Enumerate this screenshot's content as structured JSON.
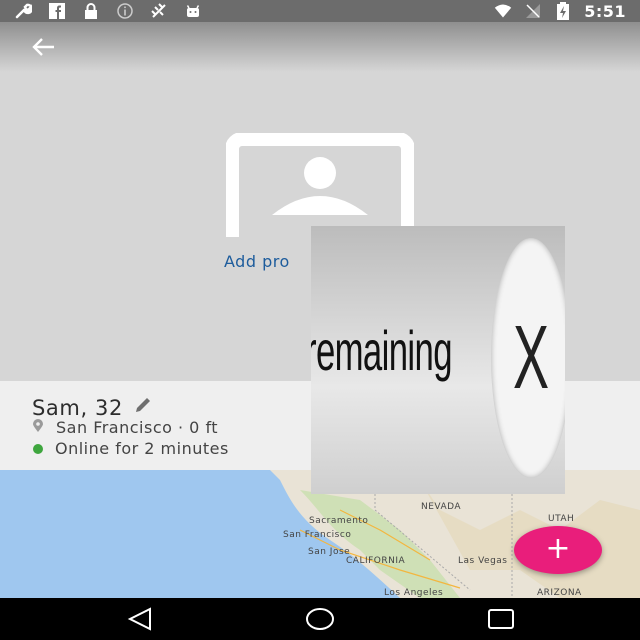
{
  "status_bar": {
    "time": "5:51",
    "left_icons": [
      "wrench-icon",
      "facebook-icon",
      "lock-icon",
      "info-icon",
      "satellite-icon",
      "android-icon"
    ],
    "right_icons": [
      "wifi-icon",
      "signal-icon",
      "battery-icon"
    ]
  },
  "header": {
    "back_icon": "arrow-left-icon"
  },
  "profile": {
    "add_photo_label": "Add pro",
    "name": "Sam",
    "age": "32",
    "location": "San Francisco · 0 ft",
    "online_status": "Online for 2 minutes"
  },
  "map": {
    "labels": [
      "NEVADA",
      "UTAH",
      "Sacramento",
      "San Francisco",
      "San Jose",
      "CALIFORNIA",
      "Las Vegas",
      "Los Angeles",
      "ARIZONA"
    ]
  },
  "fab": {
    "label": "+"
  },
  "overlay": {
    "text": "remaining",
    "close_label": "X"
  },
  "nav_bar": {
    "icons": [
      "back-triangle-icon",
      "home-circle-icon",
      "recents-square-icon"
    ]
  },
  "colors": {
    "accent": "#e91e7b",
    "link": "#1d5c9c",
    "online": "#3ea63e"
  }
}
